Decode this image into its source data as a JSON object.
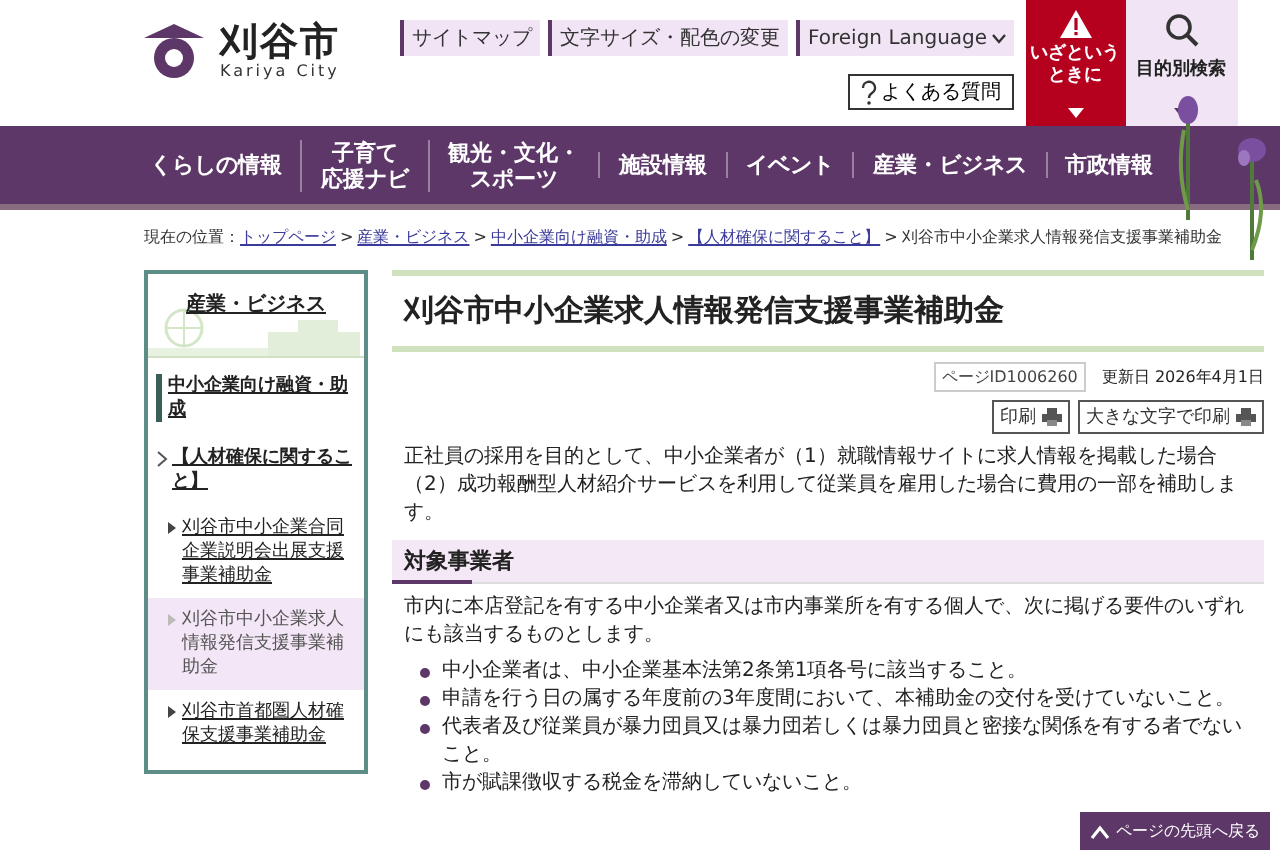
{
  "header": {
    "logo_title": "刈谷市",
    "logo_subtitle": "Kariya City",
    "utility_links": [
      {
        "label": "サイトマップ",
        "kind": "link"
      },
      {
        "label": "文字サイズ・配色の変更",
        "kind": "link"
      },
      {
        "label": "Foreign Language",
        "kind": "dropdown"
      }
    ],
    "faq_button": "よくある質問",
    "emergency_button": [
      "いざという",
      "ときに"
    ],
    "search_button": "目的別検索"
  },
  "nav": [
    {
      "lines": [
        "くらしの情報"
      ]
    },
    {
      "lines": [
        "子育て",
        "応援ナビ"
      ]
    },
    {
      "lines": [
        "観光・文化・",
        "スポーツ"
      ]
    },
    {
      "lines": [
        "施設情報"
      ]
    },
    {
      "lines": [
        "イベント"
      ]
    },
    {
      "lines": [
        "産業・ビジネス"
      ]
    },
    {
      "lines": [
        "市政情報"
      ]
    }
  ],
  "breadcrumb": {
    "label": "現在の位置：",
    "items": [
      {
        "text": "トップページ",
        "kind": "link"
      },
      {
        "text": ">",
        "kind": "separator"
      },
      {
        "text": "産業・ビジネス",
        "kind": "link"
      },
      {
        "text": ">",
        "kind": "separator"
      },
      {
        "text": "中小企業向け融資・助成",
        "kind": "link"
      },
      {
        "text": ">",
        "kind": "separator"
      },
      {
        "text": "【人材確保に関すること】",
        "kind": "link"
      },
      {
        "text": ">",
        "kind": "separator"
      },
      {
        "text": "刈谷市中小企業求人情報発信支援事業補助金",
        "kind": "current"
      }
    ]
  },
  "sidebar": {
    "heading": "産業・ビジネス",
    "category": "中小企業向け融資・助成",
    "group": "【人材確保に関すること】",
    "items": [
      {
        "label": "刈谷市中小企業合同企業説明会出展支援事業補助金",
        "selected": false
      },
      {
        "label": "刈谷市中小企業求人情報発信支援事業補助金",
        "selected": true
      },
      {
        "label": "刈谷市首都圏人材確保支援事業補助金",
        "selected": false
      }
    ]
  },
  "article": {
    "title": "刈谷市中小企業求人情報発信支援事業補助金",
    "page_id": "ページID1006260",
    "updated": "更新日 2026年4月1日",
    "print_buttons": [
      "印刷",
      "大きな文字で印刷"
    ],
    "intro": "正社員の採用を目的として、中小企業者が（1）就職情報サイトに求人情報を掲載した場合（2）成功報酬型人材紹介サービスを利用して従業員を雇用した場合に費用の一部を補助します。",
    "section_heading": "対象事業者",
    "section_text": "市内に本店登記を有する中小企業者又は市内事業所を有する個人で、次に掲げる要件のいずれにも該当するものとします。",
    "requirements": [
      "中小企業者は、中小企業基本法第2条第1項各号に該当すること。",
      "申請を行う日の属する年度前の3年度間において、本補助金の交付を受けていないこと。",
      "代表者及び従業員が暴力団員又は暴力団若しくは暴力団員と密接な関係を有する者でないこと。",
      "市が賦課徴収する税金を滞納していないこと。"
    ]
  },
  "back_to_top": "ページの先頭へ戻る"
}
